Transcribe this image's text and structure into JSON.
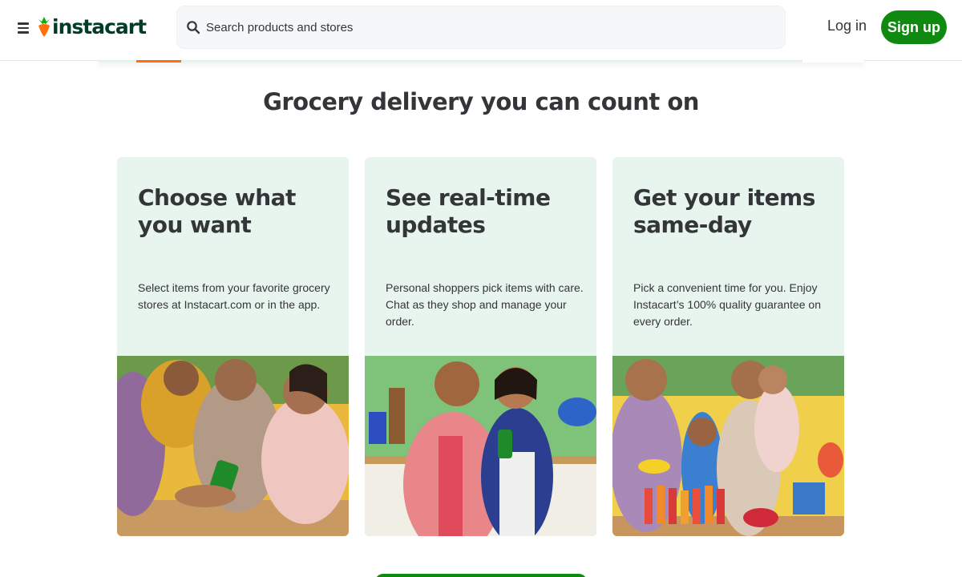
{
  "header": {
    "logo_text": "instacart",
    "search_placeholder": "Search products and stores",
    "login_label": "Log in",
    "signup_label": "Sign up"
  },
  "headline": "Grocery delivery you can count on",
  "cards": [
    {
      "title": "Choose what you want",
      "description": "Select items from your favorite grocery stores at Instacart.com or in the app."
    },
    {
      "title": "See real-time updates",
      "description": "Personal shoppers pick items with care. Chat as they shop and manage your order."
    },
    {
      "title": "Get your items same-day",
      "description": "Pick a convenient time for you. Enjoy Instacart’s 100% quality guarantee on every order."
    }
  ],
  "colors": {
    "brand_green": "#108910",
    "logo_dark": "#003d29",
    "carrot_orange": "#ff7009",
    "card_bg": "#e8f4ee"
  },
  "icons": [
    "menu-icon",
    "carrot-logo-icon",
    "search-icon"
  ]
}
